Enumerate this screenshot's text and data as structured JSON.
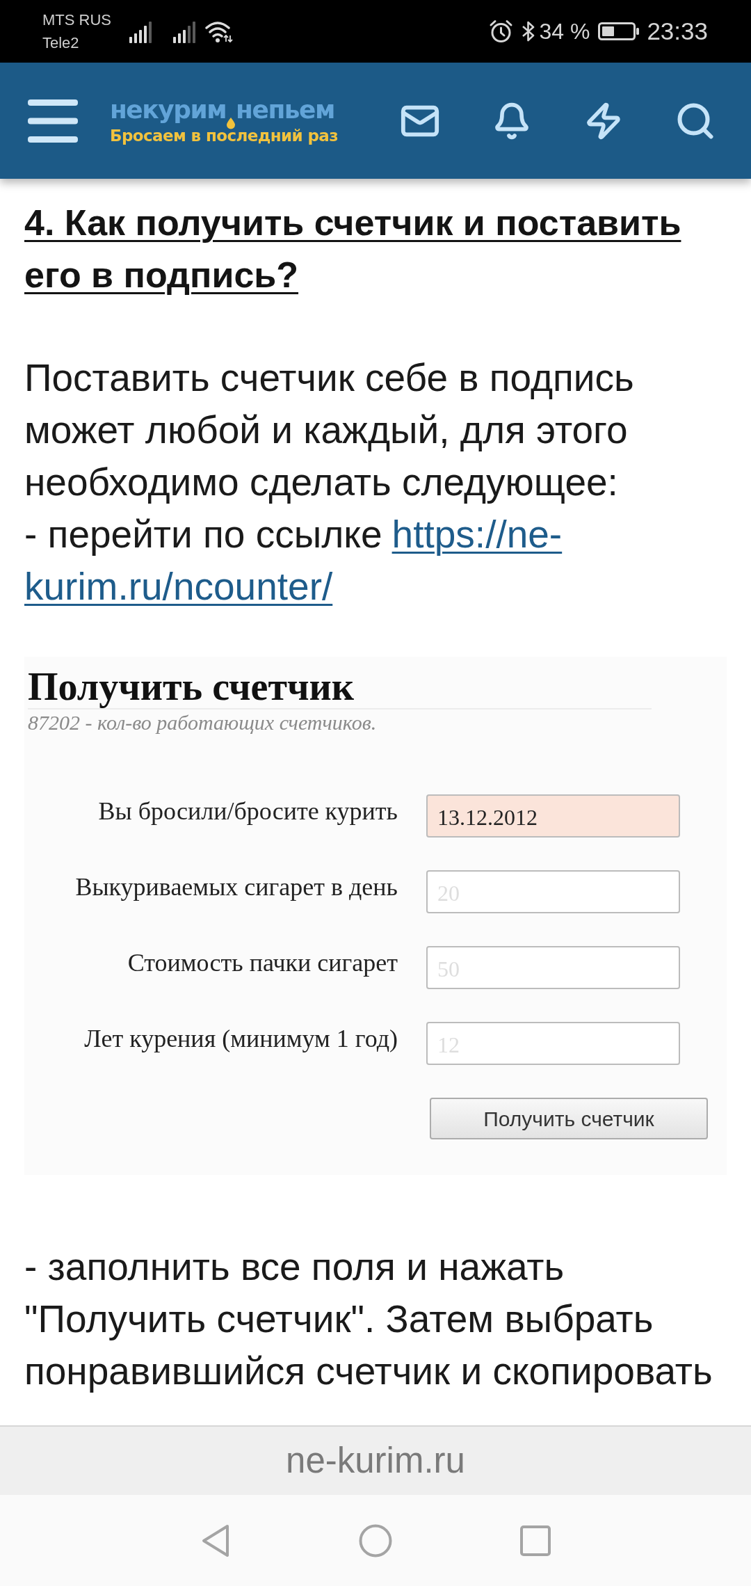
{
  "status_bar": {
    "carriers": [
      "MTS RUS",
      "Tele2"
    ],
    "battery_text": "34 %",
    "time": "23:33"
  },
  "header": {
    "logo": {
      "words": [
        "некурим",
        "непьем"
      ],
      "tagline": "Бросаем в последний раз"
    }
  },
  "article": {
    "heading": "4. Как получить счетчик и поставить его в подпись?",
    "intro": "Поставить счетчик себе в подпись может любой и каждый, для этого необходимо сделать следующее:",
    "step_1": {
      "text": "- перейти по ссылке",
      "link_lines": [
        "https://ne-",
        "kurim.ru/ncounter/"
      ]
    },
    "form_screenshot": {
      "title": "Получить счетчик",
      "subtitle": "87202 - кол-во работающих счетчиков.",
      "fields": [
        {
          "label": "Вы бросили/бросите курить",
          "value": "13.12.2012",
          "highlighted": true
        },
        {
          "label": "Выкуриваемых сигарет в день",
          "placeholder": "20",
          "highlighted": false
        },
        {
          "label": "Стоимость пачки сигарет",
          "placeholder": "50",
          "highlighted": false
        },
        {
          "label": "Лет курения (минимум 1 год)",
          "placeholder": "12",
          "highlighted": false
        }
      ],
      "button": "Получить счетчик"
    },
    "step_2": "- заполнить все поля и нажать \"Получить счетчик\". Затем выбрать понравившийся счетчик и скопировать"
  },
  "address_bar": {
    "url": "ne-kurim.ru"
  }
}
